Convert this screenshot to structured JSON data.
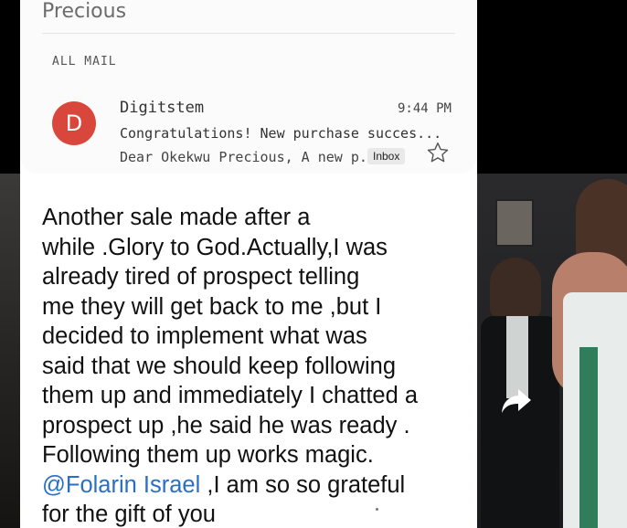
{
  "header": {
    "contact_name": "Precious",
    "folder_label": "ALL MAIL"
  },
  "email": {
    "avatar_letter": "D",
    "sender": "Digitstem",
    "time": "9:44 PM",
    "subject": "Congratulations! New purchase succes...",
    "snippet": "Dear Okekwu Precious, A new p...",
    "label": "Inbox",
    "star_icon": "star-outline-icon"
  },
  "post": {
    "lines": [
      "Another sale made after a",
      "while .Glory to God.Actually,I was",
      "already tired of prospect telling",
      "me they will get back to me ,but  I",
      "decided to implement what was",
      "said that we should keep following",
      "them up and immediately I chatted a",
      "prospect up ,he said he was ready .",
      "Following them up works magic."
    ],
    "mention": "@Folarin Israel",
    "after_mention": " ,I am so so grateful",
    "last_line": "for the gift of you"
  },
  "colors": {
    "avatar": "#d9473c",
    "mention": "#2a6fc4"
  },
  "share_icon": "share-arrow-icon"
}
